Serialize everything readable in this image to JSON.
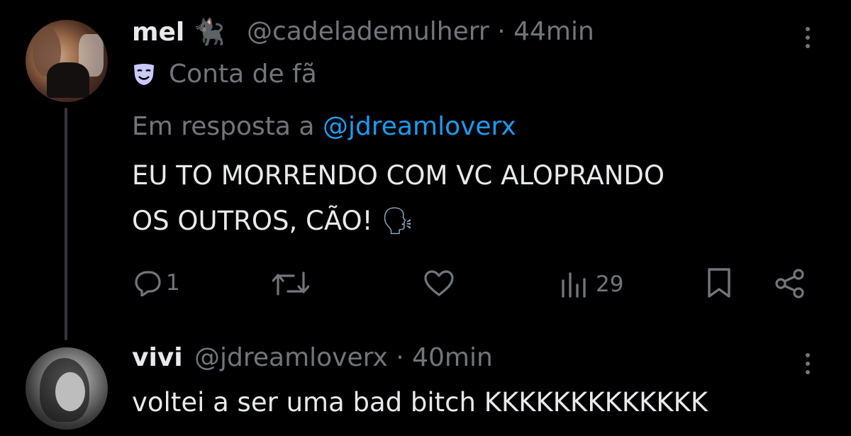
{
  "post1": {
    "display_name": "mel",
    "name_emoji": "🐈‍⬛",
    "handle": "@cadelademulherr",
    "separator": "·",
    "time": "44min",
    "badge_icon": "theater-mask-icon",
    "badge_text": "Conta de fã",
    "reply_prefix": "Em resposta a",
    "reply_to": "@jdreamloverx",
    "text_line1": "EU TO MORRENDO COM VC ALOPRANDO",
    "text_line2": "OS OUTROS, CÃO!",
    "text_emoji": "🗣",
    "actions": {
      "reply_count": "1",
      "views_count": "29"
    }
  },
  "post2": {
    "display_name": "vivi",
    "handle": "@jdreamloverx",
    "separator": "·",
    "time": "40min",
    "text": "voltei a ser uma bad bitch KKKKKKKKKKKKK"
  },
  "colors": {
    "background": "#000000",
    "primary_text": "#e7e9ea",
    "secondary_text": "#71767b",
    "link": "#1d9bf0",
    "thread_line": "#333639"
  }
}
